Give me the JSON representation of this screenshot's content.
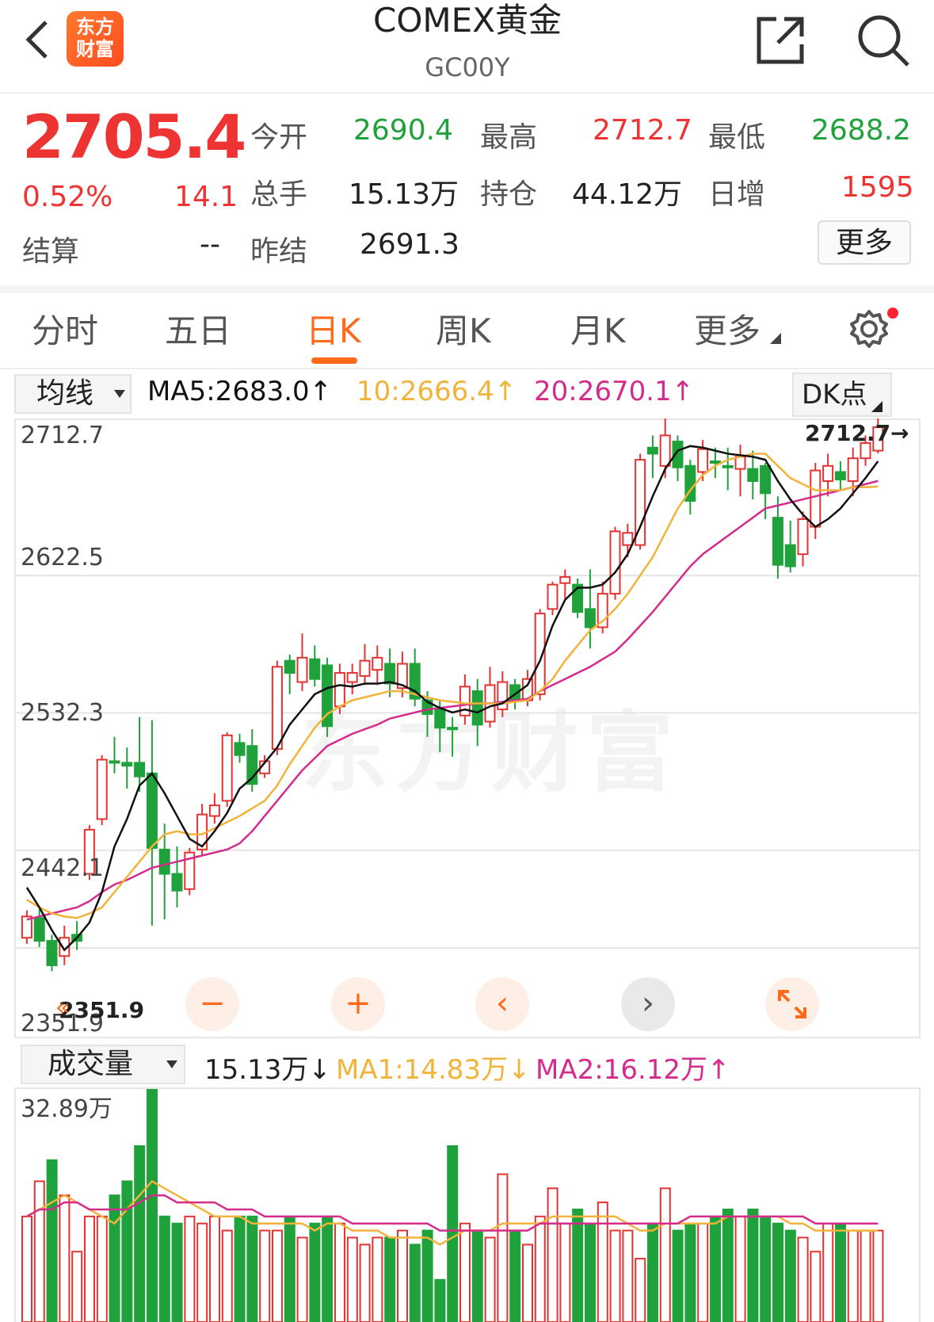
{
  "header": {
    "title": "COMEX黄金",
    "code": "GC00Y",
    "logo_line1": "东方",
    "logo_line2": "财富"
  },
  "quote": {
    "price": "2705.4",
    "change_pct": "0.52%",
    "change": "14.1",
    "settle_label": "结算",
    "settle_value": "--",
    "fields": [
      {
        "label": "今开",
        "value": "2690.4"
      },
      {
        "label": "最高",
        "value": "2712.7"
      },
      {
        "label": "最低",
        "value": "2688.2"
      },
      {
        "label": "总手",
        "value": "15.13万"
      },
      {
        "label": "持仓",
        "value": "44.12万"
      },
      {
        "label": "日增",
        "value": "1595"
      },
      {
        "label": "昨结",
        "value": "2691.3"
      }
    ],
    "more_label": "更多"
  },
  "tabs": [
    {
      "label": "分时"
    },
    {
      "label": "五日"
    },
    {
      "label": "日K"
    },
    {
      "label": "周K"
    },
    {
      "label": "月K"
    },
    {
      "label": "更多"
    }
  ],
  "indicator": {
    "select_label": "均线",
    "ma5": "MA5:2683.0↑",
    "ma10": "10:2666.4↑",
    "ma20": "20:2670.1↑",
    "dk_label": "DK点",
    "colors": {
      "ma5": "#111111",
      "ma10": "#f2b33a",
      "ma20": "#d42b8d",
      "up": "#e33333",
      "down": "#1fa23b"
    }
  },
  "kchart": {
    "y_labels": [
      "2712.7",
      "2622.5",
      "2532.3",
      "2442.1",
      "2351.9"
    ],
    "max_label": "2712.7→",
    "min_label": "2351.9",
    "watermark": "东方财富"
  },
  "volume": {
    "select_label": "成交量",
    "value": "15.13万↓",
    "ma1": "MA1:14.83万↓",
    "ma2": "MA2:16.12万↑",
    "max_label": "32.89万"
  },
  "chart_data": {
    "type": "candlestick",
    "ylim": [
      2351.9,
      2712.7
    ],
    "y_ticks": [
      2712.7,
      2622.5,
      2532.3,
      2442.1,
      2351.9
    ],
    "candles": [
      [
        2370,
        2384,
        2366,
        2388,
        1
      ],
      [
        2383,
        2368,
        2364,
        2389,
        0
      ],
      [
        2368,
        2351.9,
        2348,
        2372,
        0
      ],
      [
        2358,
        2370,
        2352,
        2378,
        1
      ],
      [
        2372,
        2368,
        2362,
        2381,
        0
      ],
      [
        2412,
        2441,
        2408,
        2444,
        1
      ],
      [
        2448,
        2487,
        2444,
        2490,
        1
      ],
      [
        2486,
        2485,
        2478,
        2502,
        0
      ],
      [
        2485,
        2483,
        2468,
        2495,
        0
      ],
      [
        2485,
        2476,
        2466,
        2515,
        0
      ],
      [
        2478,
        2429,
        2378,
        2513,
        0
      ],
      [
        2428,
        2412,
        2382,
        2445,
        0
      ],
      [
        2412,
        2401,
        2390,
        2430,
        0
      ],
      [
        2402,
        2426,
        2398,
        2429,
        1
      ],
      [
        2428,
        2451,
        2424,
        2458,
        1
      ],
      [
        2450,
        2457,
        2445,
        2465,
        1
      ],
      [
        2460,
        2503,
        2456,
        2505,
        1
      ],
      [
        2498,
        2490,
        2485,
        2504,
        0
      ],
      [
        2496,
        2471,
        2466,
        2507,
        0
      ],
      [
        2478,
        2486,
        2475,
        2490,
        1
      ],
      [
        2494,
        2548,
        2490,
        2552,
        1
      ],
      [
        2552,
        2544,
        2530,
        2556,
        0
      ],
      [
        2538,
        2554,
        2532,
        2570,
        1
      ],
      [
        2553,
        2540,
        2535,
        2562,
        0
      ],
      [
        2549,
        2509,
        2502,
        2554,
        0
      ],
      [
        2522,
        2544,
        2517,
        2550,
        1
      ],
      [
        2538,
        2544,
        2530,
        2550,
        1
      ],
      [
        2542,
        2552,
        2536,
        2563,
        1
      ],
      [
        2546,
        2554,
        2536,
        2562,
        1
      ],
      [
        2550,
        2537,
        2528,
        2560,
        0
      ],
      [
        2534,
        2550,
        2528,
        2558,
        1
      ],
      [
        2550,
        2527,
        2522,
        2560,
        0
      ],
      [
        2526,
        2517,
        2502,
        2532,
        0
      ],
      [
        2520,
        2508,
        2492,
        2526,
        0
      ],
      [
        2508,
        2508,
        2489,
        2515,
        0
      ],
      [
        2516,
        2535,
        2510,
        2543,
        1
      ],
      [
        2532,
        2510,
        2496,
        2540,
        0
      ],
      [
        2512,
        2536,
        2508,
        2548,
        1
      ],
      [
        2520,
        2538,
        2515,
        2545,
        1
      ],
      [
        2536,
        2526,
        2520,
        2540,
        0
      ],
      [
        2526,
        2540,
        2522,
        2546,
        1
      ],
      [
        2530,
        2583,
        2526,
        2586,
        1
      ],
      [
        2586,
        2602,
        2582,
        2604,
        1
      ],
      [
        2603,
        2607,
        2592,
        2612,
        1
      ],
      [
        2602,
        2584,
        2580,
        2606,
        0
      ],
      [
        2586,
        2574,
        2560,
        2612,
        0
      ],
      [
        2574,
        2596,
        2570,
        2604,
        1
      ],
      [
        2596,
        2637,
        2592,
        2640,
        1
      ],
      [
        2628,
        2636,
        2620,
        2642,
        1
      ],
      [
        2628,
        2684,
        2625,
        2688,
        1
      ],
      [
        2688,
        2692,
        2672,
        2700,
        0
      ],
      [
        2680,
        2700,
        2672,
        2712.7,
        1
      ],
      [
        2696,
        2679,
        2670,
        2700,
        0
      ],
      [
        2680,
        2657,
        2648,
        2684,
        0
      ],
      [
        2676,
        2691,
        2670,
        2697,
        1
      ],
      [
        2683,
        2682,
        2672,
        2692,
        0
      ],
      [
        2680,
        2679,
        2664,
        2692,
        0
      ],
      [
        2678,
        2686,
        2660,
        2694,
        1
      ],
      [
        2678,
        2670,
        2658,
        2690,
        0
      ],
      [
        2680,
        2662,
        2645,
        2682,
        0
      ],
      [
        2646,
        2615,
        2606,
        2660,
        0
      ],
      [
        2628,
        2614,
        2610,
        2644,
        0
      ],
      [
        2622,
        2645,
        2614,
        2650,
        1
      ],
      [
        2640,
        2677,
        2632,
        2682,
        1
      ],
      [
        2670,
        2680,
        2660,
        2688,
        1
      ],
      [
        2676,
        2671,
        2664,
        2683,
        0
      ],
      [
        2670,
        2685,
        2660,
        2692,
        1
      ],
      [
        2685,
        2695,
        2680,
        2700,
        1
      ],
      [
        2690,
        2705.4,
        2688.2,
        2712.7,
        1
      ]
    ],
    "ma5": [
      2403,
      2390,
      2375,
      2362,
      2370,
      2380,
      2400,
      2430,
      2448,
      2470,
      2478,
      2465,
      2450,
      2435,
      2430,
      2440,
      2452,
      2468,
      2475,
      2485,
      2495,
      2510,
      2520,
      2530,
      2534,
      2536,
      2535,
      2537,
      2537,
      2538,
      2536,
      2532,
      2525,
      2521,
      2518,
      2520,
      2518,
      2522,
      2524,
      2530,
      2536,
      2552,
      2575,
      2592,
      2600,
      2600,
      2602,
      2610,
      2622,
      2640,
      2660,
      2678,
      2690,
      2693,
      2692,
      2690,
      2688,
      2687,
      2686,
      2684,
      2670,
      2658,
      2648,
      2640,
      2645,
      2652,
      2662,
      2672,
      2683
    ],
    "ma10": [
      2395,
      2390,
      2386,
      2384,
      2383,
      2386,
      2390,
      2400,
      2410,
      2420,
      2430,
      2438,
      2440,
      2438,
      2438,
      2442,
      2446,
      2450,
      2455,
      2460,
      2470,
      2484,
      2496,
      2508,
      2517,
      2522,
      2526,
      2528,
      2530,
      2532,
      2532,
      2530,
      2528,
      2526,
      2525,
      2524,
      2524,
      2524,
      2524,
      2525,
      2526,
      2532,
      2540,
      2552,
      2562,
      2572,
      2578,
      2586,
      2596,
      2608,
      2620,
      2636,
      2652,
      2664,
      2674,
      2680,
      2684,
      2686,
      2688,
      2688,
      2680,
      2672,
      2668,
      2664,
      2664,
      2664,
      2666,
      2666,
      2666.4
    ],
    "ma20": [
      2382,
      2384,
      2386,
      2388,
      2390,
      2394,
      2400,
      2405,
      2408,
      2412,
      2416,
      2418,
      2420,
      2422,
      2424,
      2426,
      2428,
      2432,
      2440,
      2450,
      2460,
      2470,
      2480,
      2488,
      2496,
      2500,
      2504,
      2507,
      2510,
      2514,
      2516,
      2518,
      2520,
      2521,
      2522,
      2523,
      2524,
      2524,
      2525,
      2526,
      2527,
      2532,
      2536,
      2540,
      2544,
      2548,
      2553,
      2558,
      2566,
      2575,
      2584,
      2594,
      2604,
      2614,
      2622,
      2628,
      2634,
      2640,
      2646,
      2652,
      2654,
      2656,
      2658,
      2660,
      2662,
      2664,
      2666,
      2668,
      2670.1
    ],
    "volume_max": 32.89,
    "volume": [
      15,
      20,
      23,
      18,
      10,
      15,
      15,
      18,
      20,
      25,
      33,
      15,
      14,
      15,
      14,
      15,
      13,
      15,
      15,
      13,
      13,
      15,
      12,
      14,
      15,
      14,
      12,
      11,
      12,
      12,
      13,
      11,
      13,
      6,
      25,
      14,
      13,
      12,
      21,
      13,
      11,
      15,
      19,
      14,
      16,
      14,
      17,
      13,
      13,
      9,
      14,
      19,
      13,
      14,
      14,
      15,
      16,
      15,
      16,
      15,
      14,
      13,
      12,
      10,
      14,
      14,
      13,
      13,
      13
    ],
    "volume_up": [
      1,
      1,
      0,
      1,
      1,
      1,
      1,
      0,
      0,
      0,
      0,
      0,
      0,
      1,
      1,
      1,
      1,
      0,
      0,
      1,
      1,
      0,
      1,
      0,
      0,
      1,
      1,
      1,
      1,
      0,
      1,
      0,
      0,
      0,
      0,
      1,
      0,
      1,
      1,
      0,
      1,
      1,
      1,
      1,
      0,
      0,
      1,
      1,
      1,
      1,
      0,
      1,
      0,
      0,
      1,
      0,
      0,
      1,
      0,
      0,
      0,
      0,
      1,
      1,
      1,
      0,
      1,
      1,
      1
    ],
    "vol_ma1": [
      15,
      16,
      17,
      18,
      17,
      16,
      15,
      14,
      16,
      18,
      20,
      19,
      18,
      17,
      16,
      15,
      15,
      15,
      14,
      14,
      14,
      14,
      14,
      13,
      14,
      14,
      13,
      13,
      13,
      12,
      12,
      12,
      12,
      11,
      12,
      13,
      13,
      13,
      14,
      14,
      14,
      14,
      15,
      15,
      15,
      15,
      15,
      15,
      14,
      13,
      13,
      14,
      14,
      14,
      14,
      14,
      15,
      15,
      15,
      15,
      15,
      14,
      14,
      13,
      13,
      13,
      13,
      13,
      13
    ],
    "vol_ma2": [
      15,
      16,
      16,
      17,
      17,
      16,
      16,
      16,
      16,
      17,
      18,
      18,
      17,
      17,
      17,
      17,
      16,
      16,
      16,
      15,
      15,
      15,
      15,
      15,
      15,
      15,
      14,
      14,
      14,
      14,
      14,
      14,
      14,
      13,
      13,
      13,
      13,
      13,
      13,
      13,
      13,
      14,
      14,
      14,
      14,
      14,
      14,
      14,
      14,
      14,
      14,
      14,
      14,
      15,
      15,
      15,
      15,
      15,
      15,
      15,
      15,
      15,
      15,
      14,
      14,
      14,
      14,
      14,
      14
    ]
  }
}
